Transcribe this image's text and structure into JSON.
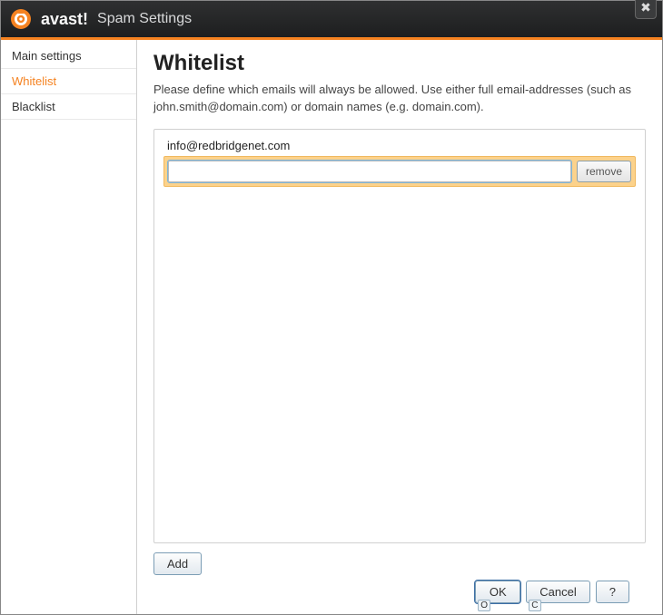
{
  "brand": "avast!",
  "window_title": "Spam Settings",
  "accent_color": "#f58220",
  "sidebar": {
    "items": [
      {
        "label": "Main settings",
        "active": false
      },
      {
        "label": "Whitelist",
        "active": true
      },
      {
        "label": "Blacklist",
        "active": false
      }
    ]
  },
  "page": {
    "heading": "Whitelist",
    "description": "Please define which emails will always be allowed. Use either full email-addresses (such as john.smith@domain.com) or domain names (e.g. domain.com).",
    "entries": [
      {
        "email": "info@redbridgenet.com",
        "input_value": ""
      }
    ],
    "remove_label": "remove",
    "add_label": "Add"
  },
  "footer": {
    "ok_label": "OK",
    "ok_mnemonic": "O",
    "cancel_label": "Cancel",
    "cancel_mnemonic": "C",
    "help_label": "?"
  },
  "close_glyph": "✖"
}
